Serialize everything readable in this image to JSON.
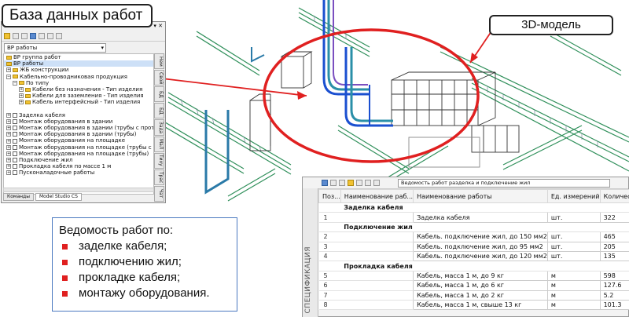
{
  "callouts": {
    "database": "База данных работ",
    "model3d": "3D-модель"
  },
  "summary": {
    "heading": "Ведомость работ по:",
    "items": [
      "заделке кабеля;",
      "подключению жил;",
      "прокладке кабеля;",
      "монтажу оборудования."
    ]
  },
  "panel": {
    "title": "Model Studio CS",
    "controls": "▾ ✕",
    "selector": "ВР работы",
    "tree": [
      {
        "label": "ВР группа работ",
        "indent": 0,
        "icon": "folder",
        "expander": "",
        "selected": false
      },
      {
        "label": "ВР работы",
        "indent": 0,
        "icon": "folder",
        "expander": "",
        "selected": true
      },
      {
        "label": "ЖБ конструкции",
        "indent": 0,
        "icon": "folder",
        "expander": "+",
        "selected": false
      },
      {
        "label": "Кабельно-проводниковая продукция",
        "indent": 0,
        "icon": "folder",
        "expander": "−",
        "selected": false
      },
      {
        "label": "По типу",
        "indent": 1,
        "icon": "folder",
        "expander": "−",
        "selected": false
      },
      {
        "label": "Кабели без назначения - Тип изделия",
        "indent": 2,
        "icon": "folder",
        "expander": "+",
        "selected": false
      },
      {
        "label": "Кабели для заземления - Тип изделия",
        "indent": 2,
        "icon": "folder",
        "expander": "+",
        "selected": false
      },
      {
        "label": "Кабель интерфейсный - Тип изделия",
        "indent": 2,
        "icon": "folder",
        "expander": "+",
        "selected": false
      },
      {
        "label": "",
        "indent": 0,
        "icon": "none",
        "expander": "",
        "selected": false
      },
      {
        "label": "Заделка кабеля",
        "indent": 0,
        "icon": "box",
        "expander": "+",
        "selected": false
      },
      {
        "label": "Монтаж оборудования в здании",
        "indent": 0,
        "icon": "box",
        "expander": "+",
        "selected": false
      },
      {
        "label": "Монтаж оборудования в здании (трубы с прототипом)",
        "indent": 0,
        "icon": "box",
        "expander": "+",
        "selected": false
      },
      {
        "label": "Монтаж оборудования в здании (трубы)",
        "indent": 0,
        "icon": "box",
        "expander": "+",
        "selected": false
      },
      {
        "label": "Монтаж оборудования на площадке",
        "indent": 0,
        "icon": "box",
        "expander": "+",
        "selected": false
      },
      {
        "label": "Монтаж оборудования на площадке (трубы с прототипом)",
        "indent": 0,
        "icon": "box",
        "expander": "+",
        "selected": false
      },
      {
        "label": "Монтаж оборудования на площадке (трубы)",
        "indent": 0,
        "icon": "box",
        "expander": "+",
        "selected": false
      },
      {
        "label": "Подключение жил",
        "indent": 0,
        "icon": "box",
        "expander": "+",
        "selected": false
      },
      {
        "label": "Прокладка кабеля по массе 1 м",
        "indent": 0,
        "icon": "box",
        "expander": "+",
        "selected": false
      },
      {
        "label": "Пусконаладочные работы",
        "indent": 0,
        "icon": "box",
        "expander": "+",
        "selected": false
      }
    ],
    "side_tabs": [
      "Нем",
      "Свой",
      "БД",
      "БД",
      "Зада",
      "МаЛ",
      "Тиху",
      "Трас",
      "Чат"
    ],
    "bottom_tabs": [
      "Команды",
      "Model Studio CS"
    ]
  },
  "spec": {
    "vertical_label": "СПЕЦИФИКАЦИЯ",
    "toolbar_select": "Ведомость работ разделка и подключение жил",
    "columns": [
      "Поз...",
      "Наименование раб...",
      "Наименование работы",
      "Ед. измерений",
      "Количество (в"
    ],
    "rows": [
      {
        "type": "group",
        "name": "Заделка кабеля"
      },
      {
        "type": "item",
        "pos": "1",
        "work": "Заделка кабеля",
        "unit": "шт.",
        "qty": "322"
      },
      {
        "type": "group",
        "name": "Подключение жил"
      },
      {
        "type": "item",
        "pos": "2",
        "work": "Кабель. подключение жил, до 150 мм2",
        "unit": "шт.",
        "qty": "465"
      },
      {
        "type": "item",
        "pos": "3",
        "work": "Кабель. подключение жил, до 95 мм2",
        "unit": "шт.",
        "qty": "205"
      },
      {
        "type": "item",
        "pos": "4",
        "work": "Кабель. подключение жил, до 120 мм2",
        "unit": "шт.",
        "qty": "135"
      },
      {
        "type": "group",
        "name": "Прокладка кабеля"
      },
      {
        "type": "item",
        "pos": "5",
        "work": "Кабель, масса 1 м, до 9 кг",
        "unit": "м",
        "qty": "598"
      },
      {
        "type": "item",
        "pos": "6",
        "work": "Кабель, масса 1 м, до 6 кг",
        "unit": "м",
        "qty": "127.6"
      },
      {
        "type": "item",
        "pos": "7",
        "work": "Кабель, масса 1 м, до 2 кг",
        "unit": "м",
        "qty": "5.2"
      },
      {
        "type": "item",
        "pos": "8",
        "work": "Кабель, масса 1 м, свыше 13 кг",
        "unit": "м",
        "qty": "101.3"
      }
    ]
  },
  "colors": {
    "highlight": "#e02020",
    "tray": "#2f8f5a",
    "pipe_blue": "#1a4fd0",
    "pipe_teal": "#2a8fa8"
  }
}
